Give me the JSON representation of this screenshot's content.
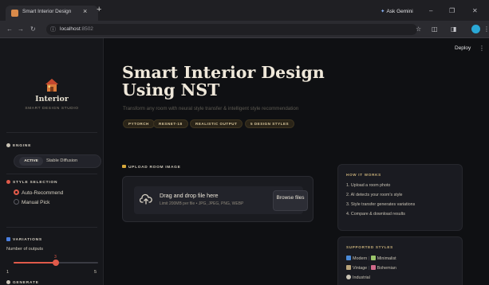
{
  "browser": {
    "tab_title": "Smart Interior Design",
    "tab_close": "×",
    "new_tab": "+",
    "gemini": "Ask Gemini",
    "url_host": "localhost",
    "url_port": ":8502",
    "minimize": "–",
    "restore": "❐",
    "close": "✕",
    "back": "←",
    "forward": "→",
    "reload": "↻",
    "star": "☆",
    "extensions": "◫",
    "sidepanel": "◨",
    "menu": "⋮"
  },
  "app": {
    "deploy_label": "Deploy",
    "kebab": "⋮"
  },
  "sidebar": {
    "brand": "Interior",
    "brand_sub": "SMART DESIGN STUDIO",
    "engine": {
      "heading": "ENGINE",
      "active": "ACTIVE",
      "name": "Stable Diffusion"
    },
    "style_selection": {
      "heading": "STYLE SELECTION",
      "options": [
        "Auto-Recommend",
        "Manual Pick"
      ],
      "selected": "Auto-Recommend"
    },
    "variations": {
      "heading": "VARIATIONS",
      "label": "Number of outputs",
      "value": 3,
      "min": 1,
      "max": 5,
      "value_text": "3",
      "min_text": "1",
      "max_text": "5"
    },
    "next_heading": "GENERATE"
  },
  "main": {
    "title": "Smart Interior Design Using NST",
    "subtitle": "Transform any room with neural style transfer & intelligent style recommendation",
    "tags": [
      "PYTORCH",
      "RESNET-18",
      "REALISTIC OUTPUT",
      "5 DESIGN STYLES"
    ],
    "upload": {
      "label": "UPLOAD ROOM IMAGE",
      "drop_title": "Drag and drop file here",
      "limit": "Limit 200MB per file • JPG, JPEG, PNG, WEBP",
      "browse": "Browse files"
    },
    "how_it_works": {
      "heading": "HOW IT WORKS",
      "steps": [
        "1. Upload a room photo",
        "2. AI detects your room's style",
        "3. Style transfer generates variations",
        "4. Compare & download results"
      ]
    },
    "supported_styles": {
      "heading": "SUPPORTED STYLES",
      "items": [
        "Modern",
        "Minimalist",
        "Vintage",
        "Bohemian",
        "Industrial"
      ]
    }
  },
  "colors": {
    "accent": "#e05a4a",
    "gold": "#c9b17a",
    "background": "#0f1013",
    "sidebar": "#16171b"
  }
}
